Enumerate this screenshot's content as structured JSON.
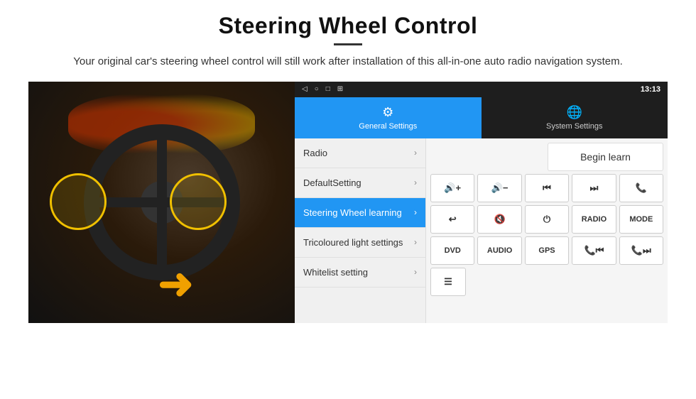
{
  "header": {
    "title": "Steering Wheel Control",
    "subtitle": "Your original car's steering wheel control will still work after installation of this all-in-one auto radio navigation system."
  },
  "status_bar": {
    "time": "13:13",
    "icons": [
      "◁",
      "○",
      "□",
      "⊞"
    ]
  },
  "tabs": [
    {
      "id": "general",
      "label": "General Settings",
      "active": true
    },
    {
      "id": "system",
      "label": "System Settings",
      "active": false
    }
  ],
  "menu_items": [
    {
      "id": "radio",
      "label": "Radio",
      "active": false
    },
    {
      "id": "default",
      "label": "DefaultSetting",
      "active": false
    },
    {
      "id": "steering",
      "label": "Steering Wheel learning",
      "active": true
    },
    {
      "id": "tricoloured",
      "label": "Tricoloured light settings",
      "active": false
    },
    {
      "id": "whitelist",
      "label": "Whitelist setting",
      "active": false
    }
  ],
  "controls": {
    "begin_learn": "Begin learn",
    "buttons": [
      [
        "🔊+",
        "🔊−",
        "⏮",
        "⏭",
        "📞"
      ],
      [
        "↩",
        "🔊✕",
        "⏻",
        "RADIO",
        "MODE"
      ],
      [
        "DVD",
        "AUDIO",
        "GPS",
        "⏮",
        "⏭"
      ]
    ]
  }
}
